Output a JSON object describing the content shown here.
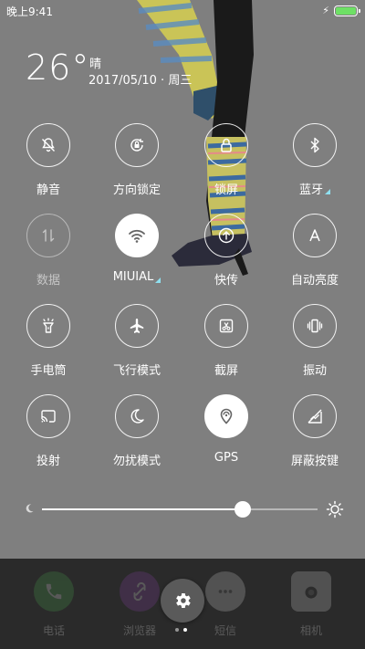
{
  "status_bar": {
    "time": "晚上9:41",
    "charging_icon": "bolt-icon",
    "battery_level": 1.0,
    "battery_color": "#6ee065"
  },
  "weather": {
    "temperature": "26°",
    "condition": "晴",
    "date": "2017/05/10 · 周三"
  },
  "toggles": [
    {
      "label": "静音",
      "icon": "bell-off-icon",
      "state": "off"
    },
    {
      "label": "方向锁定",
      "icon": "rotation-lock-icon",
      "state": "off"
    },
    {
      "label": "锁屏",
      "icon": "padlock-icon",
      "state": "off"
    },
    {
      "label": "蓝牙",
      "icon": "bluetooth-icon",
      "state": "off",
      "has_submenu": true
    },
    {
      "label": "数据",
      "icon": "mobile-data-icon",
      "state": "disabled"
    },
    {
      "label": "MIUIAL",
      "icon": "wifi-icon",
      "state": "on",
      "has_submenu": true
    },
    {
      "label": "快传",
      "icon": "quick-transfer-icon",
      "state": "off"
    },
    {
      "label": "自动亮度",
      "icon": "auto-brightness-icon",
      "state": "off"
    },
    {
      "label": "手电筒",
      "icon": "flashlight-icon",
      "state": "off"
    },
    {
      "label": "飞行模式",
      "icon": "airplane-icon",
      "state": "off"
    },
    {
      "label": "截屏",
      "icon": "screenshot-icon",
      "state": "off"
    },
    {
      "label": "振动",
      "icon": "vibrate-icon",
      "state": "off"
    },
    {
      "label": "投射",
      "icon": "cast-icon",
      "state": "off"
    },
    {
      "label": "勿扰模式",
      "icon": "moon-icon",
      "state": "off"
    },
    {
      "label": "GPS",
      "icon": "gps-icon",
      "state": "on"
    },
    {
      "label": "屏蔽按键",
      "icon": "block-keys-icon",
      "state": "off"
    }
  ],
  "brightness": {
    "level": 0.73,
    "low_icon": "moon-small-icon",
    "high_icon": "sun-icon"
  },
  "dock": {
    "apps": [
      {
        "label": "电话",
        "icon": "phone-icon"
      },
      {
        "label": "浏览器",
        "icon": "browser-icon"
      },
      {
        "label": "短信",
        "icon": "sms-icon"
      },
      {
        "label": "相机",
        "icon": "camera-icon"
      }
    ],
    "settings_icon": "gear-icon",
    "pages": 2,
    "current_page": 1
  }
}
